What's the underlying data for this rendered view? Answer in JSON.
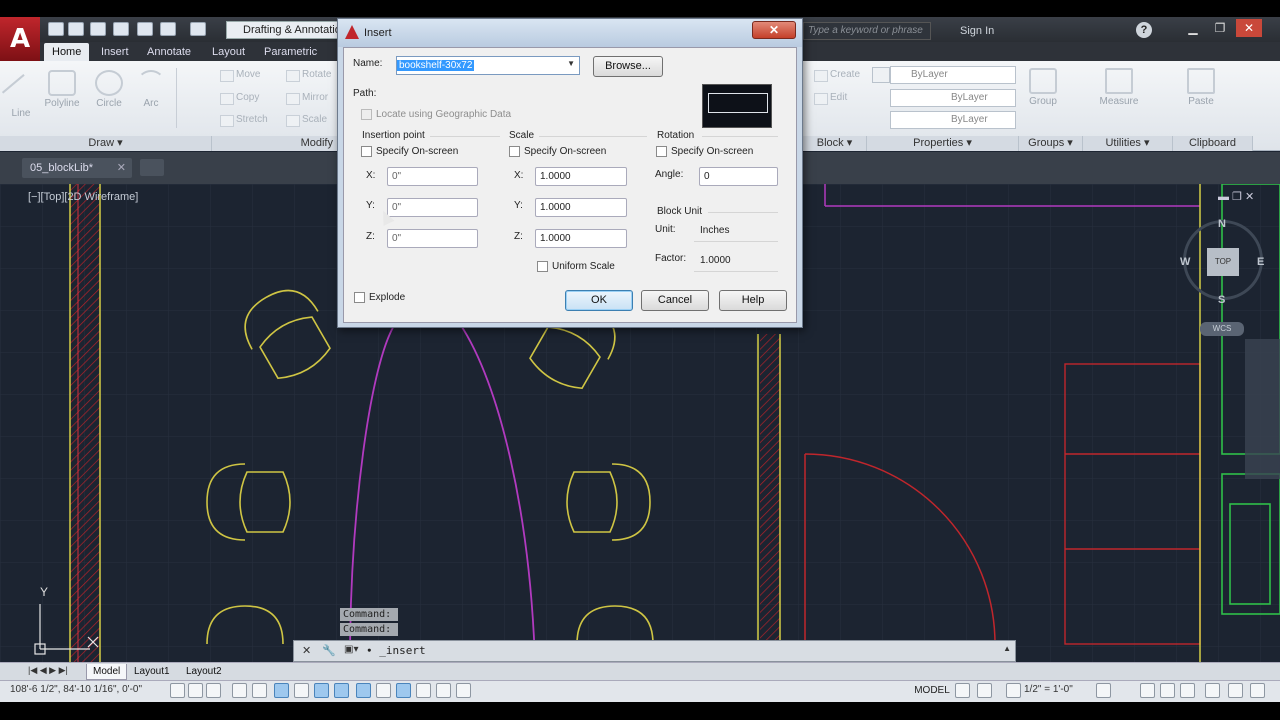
{
  "app": {
    "logo": "A",
    "workspace": "Drafting & Annotation",
    "search_placeholder": "Type a keyword or phrase",
    "sign_in": "Sign In",
    "help": "?"
  },
  "ribbon": {
    "tabs": [
      "Home",
      "Insert",
      "Annotate",
      "Layout",
      "Parametric"
    ],
    "draw": {
      "title": "Draw",
      "line": "Line",
      "polyline": "Polyline",
      "circle": "Circle",
      "arc": "Arc"
    },
    "modify": {
      "title": "Modify",
      "move": "Move",
      "rotate": "Rotate",
      "copy": "Copy",
      "mirror": "Mirror",
      "stretch": "Stretch",
      "scale": "Scale"
    },
    "block": {
      "title": "Block",
      "create": "Create",
      "edit": "Edit"
    },
    "properties": {
      "title": "Properties",
      "color": "ByLayer",
      "linetype": "ByLayer",
      "lineweight": "ByLayer"
    },
    "groups": {
      "title": "Groups",
      "group": "Group"
    },
    "utilities": {
      "title": "Utilities",
      "measure": "Measure"
    },
    "clipboard": {
      "title": "Clipboard",
      "paste": "Paste"
    }
  },
  "file_tab": "05_blockLib*",
  "viewport_label": "[−][Top][2D Wireframe]",
  "viewcube": {
    "n": "N",
    "s": "S",
    "e": "E",
    "w": "W",
    "top": "TOP",
    "wcs": "WCS"
  },
  "ucs": {
    "y": "Y"
  },
  "dialog": {
    "title": "Insert",
    "close": "✕",
    "name_label": "Name:",
    "name_value": "bookshelf-30x72",
    "browse": "Browse...",
    "path_label": "Path:",
    "geo_label": "Locate using Geographic Data",
    "insertion": {
      "title": "Insertion point",
      "specify": "Specify On-screen",
      "x_label": "X:",
      "x": "0\"",
      "y_label": "Y:",
      "y": "0\"",
      "z_label": "Z:",
      "z": "0\""
    },
    "scale": {
      "title": "Scale",
      "specify": "Specify On-screen",
      "x_label": "X:",
      "x": "1.0000",
      "y_label": "Y:",
      "y": "1.0000",
      "z_label": "Z:",
      "z": "1.0000",
      "uniform": "Uniform Scale"
    },
    "rotation": {
      "title": "Rotation",
      "specify": "Specify On-screen",
      "angle_label": "Angle:",
      "angle": "0"
    },
    "block_unit": {
      "title": "Block Unit",
      "unit_label": "Unit:",
      "unit": "Inches",
      "factor_label": "Factor:",
      "factor": "1.0000"
    },
    "explode": "Explode",
    "ok": "OK",
    "cancel": "Cancel",
    "help": "Help"
  },
  "command": {
    "history": [
      "Command:",
      "Command:"
    ],
    "prompt": "_insert"
  },
  "layout_tabs": [
    "Model",
    "Layout1",
    "Layout2"
  ],
  "status": {
    "coords": "108'-6 1/2\", 84'-10 1/16\", 0'-0\"",
    "model": "MODEL",
    "scale": "1/2\" = 1'-0\""
  }
}
